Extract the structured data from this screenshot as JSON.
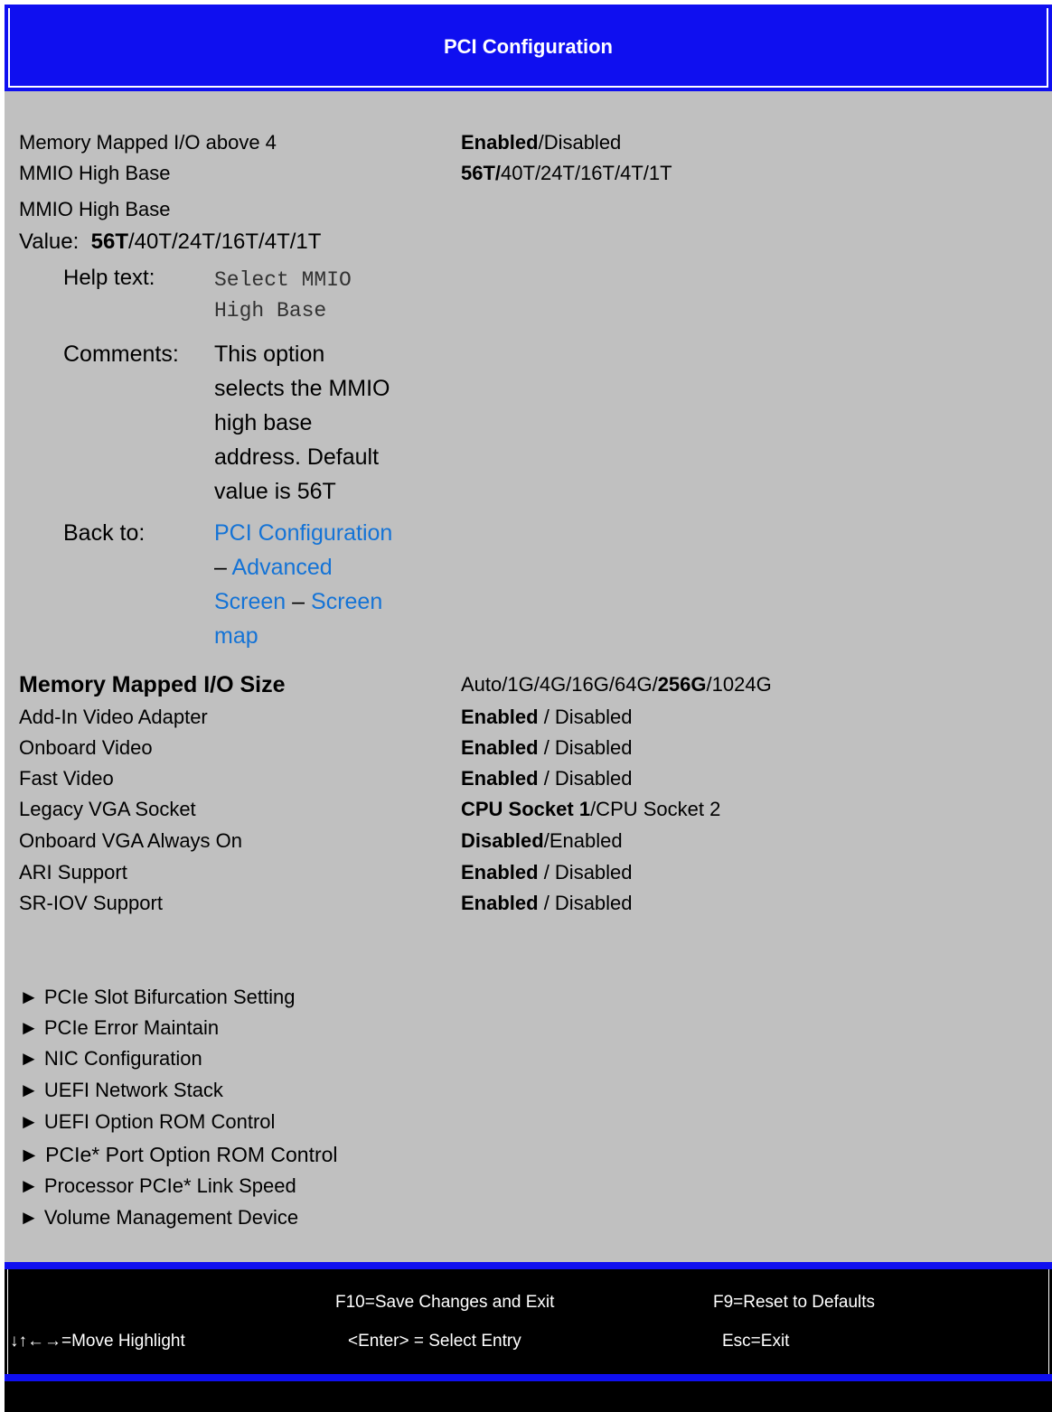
{
  "header": {
    "title": "PCI Configuration"
  },
  "settings_top": [
    {
      "label": "Memory Mapped I/O above 4",
      "options": [
        {
          "t": "Enabled",
          "b": true
        },
        {
          "t": "/Disabled",
          "b": false
        }
      ]
    },
    {
      "label": "MMIO High Base",
      "options": [
        {
          "t": "56T/",
          "b": true
        },
        {
          "t": "40T/24T/16T/4T/1T",
          "b": false
        }
      ]
    }
  ],
  "detail": {
    "name": "MMIO High Base",
    "value_label": "Value:",
    "value_default": "56T",
    "value_rest": "/40T/24T/16T/4T/1T",
    "help_label": "Help text:",
    "help_text_1": "Select MMIO",
    "help_text_2": "High Base",
    "comments_label": "Comments:",
    "comments_lines": [
      "This option",
      "selects the MMIO",
      "high base",
      "address. Default",
      "value is 56T"
    ],
    "back_label": "Back to:",
    "back_links": {
      "pci": "PCI Configuration",
      "dash1": "– ",
      "advanced": "Advanced",
      "screen": "Screen",
      "dash2": " – ",
      "map1": "Screen",
      "map2": "map"
    }
  },
  "settings": [
    {
      "label": "Memory Mapped I/O Size",
      "label_bold": true,
      "options": [
        {
          "t": "Auto/1G/4G/16G/64G/",
          "b": false
        },
        {
          "t": "256G",
          "b": true
        },
        {
          "t": "/1024G",
          "b": false
        }
      ]
    },
    {
      "label": "Add-In Video Adapter",
      "options": [
        {
          "t": "Enabled",
          "b": true
        },
        {
          "t": " / Disabled",
          "b": false
        }
      ]
    },
    {
      "label": "Onboard Video",
      "options": [
        {
          "t": "Enabled",
          "b": true
        },
        {
          "t": " / Disabled",
          "b": false
        }
      ]
    },
    {
      "label": "Fast Video",
      "options": [
        {
          "t": "Enabled",
          "b": true
        },
        {
          "t": " / Disabled",
          "b": false
        }
      ]
    },
    {
      "label": "Legacy VGA Socket",
      "options": [
        {
          "t": "CPU Socket 1",
          "b": true
        },
        {
          "t": "/CPU Socket 2",
          "b": false
        }
      ]
    },
    {
      "label": "Onboard VGA Always On",
      "options": [
        {
          "t": "Disabled",
          "b": true
        },
        {
          "t": "/Enabled",
          "b": false
        }
      ]
    },
    {
      "label": "ARI Support",
      "options": [
        {
          "t": "Enabled",
          "b": true
        },
        {
          "t": " / Disabled",
          "b": false
        }
      ]
    },
    {
      "label": "SR-IOV Support",
      "options": [
        {
          "t": "Enabled",
          "b": true
        },
        {
          "t": " / Disabled",
          "b": false
        }
      ]
    }
  ],
  "submenus": [
    "► PCIe Slot Bifurcation Setting",
    "► PCIe Error Maintain",
    "► NIC Configuration",
    "► UEFI Network Stack",
    "► UEFI Option ROM Control",
    "► PCIe* Port Option ROM Control",
    "► Processor PCIe* Link Speed",
    "► Volume Management Device"
  ],
  "footer": {
    "save_exit": "F10=Save Changes and Exit",
    "reset": "F9=Reset to Defaults",
    "arrows": "↓↑←→",
    "move": "=Move Highlight",
    "select": "<Enter> = Select Entry",
    "exit": "Esc=Exit"
  }
}
